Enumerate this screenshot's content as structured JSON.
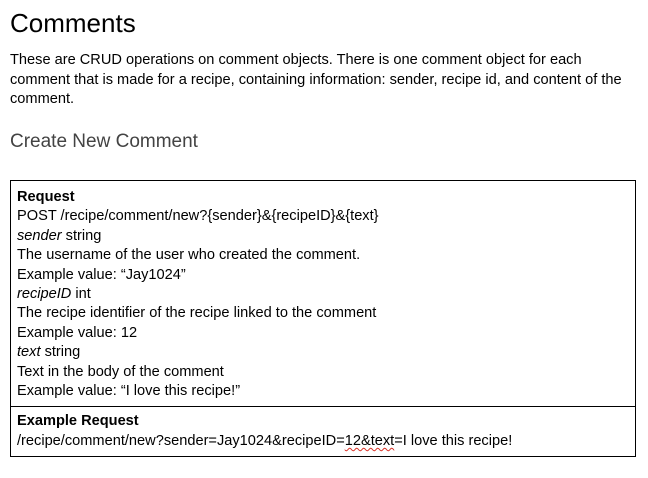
{
  "title": "Comments",
  "intro": "These are CRUD operations on comment objects. There is one comment object for each comment that is made for a recipe, containing information: sender, recipe id, and content of the comment.",
  "section_heading": "Create New Comment",
  "request": {
    "heading": "Request",
    "endpoint": "POST /recipe/comment/new?{sender}&{recipeID}&{text}",
    "params": [
      {
        "name": "sender",
        "type": " string",
        "description": "The username of the user who created the comment.",
        "example": "Example value: “Jay1024”"
      },
      {
        "name": "recipeID",
        "type": " int",
        "description": "The recipe identifier of the recipe linked to the comment",
        "example": "Example value: 12"
      },
      {
        "name": "text",
        "type": " string",
        "description": "Text in the body of the comment",
        "example": "Example value: “I love this recipe!”"
      }
    ]
  },
  "example_request": {
    "heading": "Example Request",
    "url_before": "/recipe/comment/new?sender=Jay1024&recipeID=",
    "url_flagged": "12&text",
    "url_after": "=I love this recipe!"
  }
}
